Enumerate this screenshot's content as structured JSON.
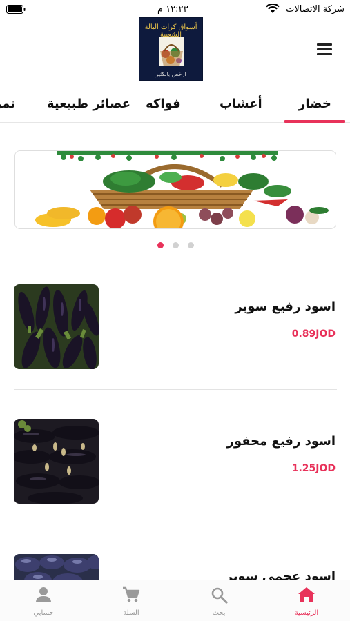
{
  "status_bar": {
    "carrier": "شركة الاتصالات",
    "time": "١٢:٢٣ م"
  },
  "header": {
    "logo_title": "أسواق كرات البالة الشعبية",
    "logo_sub": "ارخص بالكثير"
  },
  "tabs": [
    {
      "label": "خضار",
      "active": true
    },
    {
      "label": "أعشاب",
      "active": false
    },
    {
      "label": "فواكه",
      "active": false
    },
    {
      "label": "عصائر طبيعية",
      "active": false
    },
    {
      "label": "تمر",
      "active": false
    }
  ],
  "carousel": {
    "slide_count": 3,
    "active_index": 0
  },
  "products": [
    {
      "name": "اسود رفيع سوبر",
      "price": "0.89JOD"
    },
    {
      "name": "اسود رفيع محفور",
      "price": "1.25JOD"
    },
    {
      "name": "اسود عجمي سوبر",
      "price": ""
    }
  ],
  "bottom_nav": [
    {
      "label": "الرئيسية",
      "icon": "home-icon",
      "active": true
    },
    {
      "label": "بحث",
      "icon": "search-icon",
      "active": false
    },
    {
      "label": "السلة",
      "icon": "cart-icon",
      "active": false
    },
    {
      "label": "حسابي",
      "icon": "account-icon",
      "active": false
    }
  ],
  "colors": {
    "accent": "#e8325a",
    "inactive": "#999999"
  }
}
